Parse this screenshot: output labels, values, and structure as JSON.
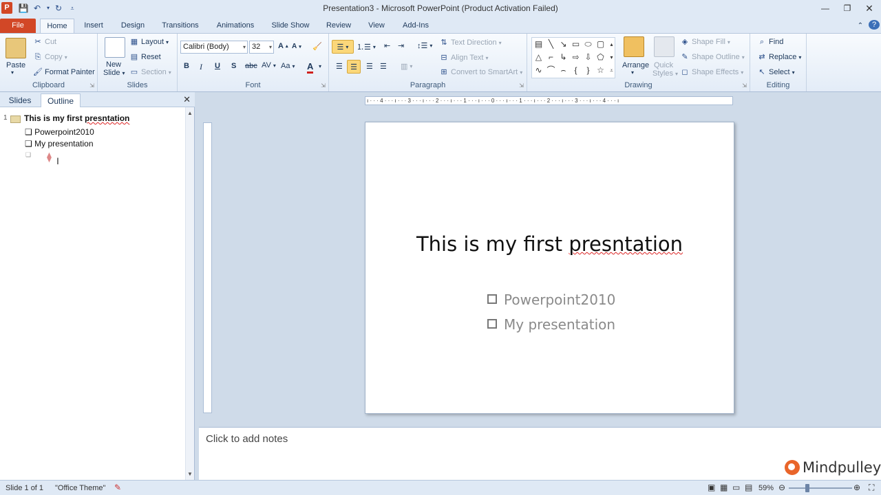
{
  "window": {
    "title": "Presentation3 - Microsoft PowerPoint (Product Activation Failed)",
    "app_letter": "P"
  },
  "tabs": [
    "File",
    "Home",
    "Insert",
    "Design",
    "Transitions",
    "Animations",
    "Slide Show",
    "Review",
    "View",
    "Add-Ins"
  ],
  "clipboard": {
    "label": "Clipboard",
    "paste": "Paste",
    "cut": "Cut",
    "copy": "Copy",
    "format_painter": "Format Painter"
  },
  "slides_group": {
    "label": "Slides",
    "new_slide_line1": "New",
    "new_slide_line2": "Slide",
    "layout": "Layout",
    "reset": "Reset",
    "section": "Section"
  },
  "font": {
    "label": "Font",
    "family": "Calibri (Body)",
    "size": "32"
  },
  "paragraph": {
    "label": "Paragraph",
    "text_direction": "Text Direction",
    "align_text": "Align Text",
    "convert_smartart": "Convert to SmartArt"
  },
  "drawing": {
    "label": "Drawing",
    "arrange": "Arrange",
    "quick_styles_line1": "Quick",
    "quick_styles_line2": "Styles",
    "shape_fill": "Shape Fill",
    "shape_outline": "Shape Outline",
    "shape_effects": "Shape Effects"
  },
  "editing": {
    "label": "Editing",
    "find": "Find",
    "replace": "Replace",
    "select": "Select"
  },
  "left_pane": {
    "tab_slides": "Slides",
    "tab_outline": "Outline",
    "slide_number": "1",
    "outline_title": "This is my first presntation",
    "outline_bullets": [
      "Powerpoint2010",
      "My presentation"
    ]
  },
  "ruler_text": "ı · · · 4 · · · ı · · · 3 · · · ı · · · 2 · · · ı · · · 1 · · · ı · · · 0 · · · ı · · · 1 · · · ı · · · 2 · · · ı · · · 3 · · · ı · · · 4 · · · ı",
  "slide": {
    "title": "This is my first presntation",
    "bullets": [
      "Powerpoint2010",
      "My presentation"
    ]
  },
  "notes": {
    "placeholder": "Click to add notes"
  },
  "status": {
    "slide_info": "Slide 1 of 1",
    "theme": "\"Office Theme\"",
    "zoom": "59%"
  },
  "watermark": "Mindpulley",
  "colors": {
    "file_tab": "#d24726",
    "accent": "#2a4e8a",
    "selected_button": "#fbd77a"
  }
}
